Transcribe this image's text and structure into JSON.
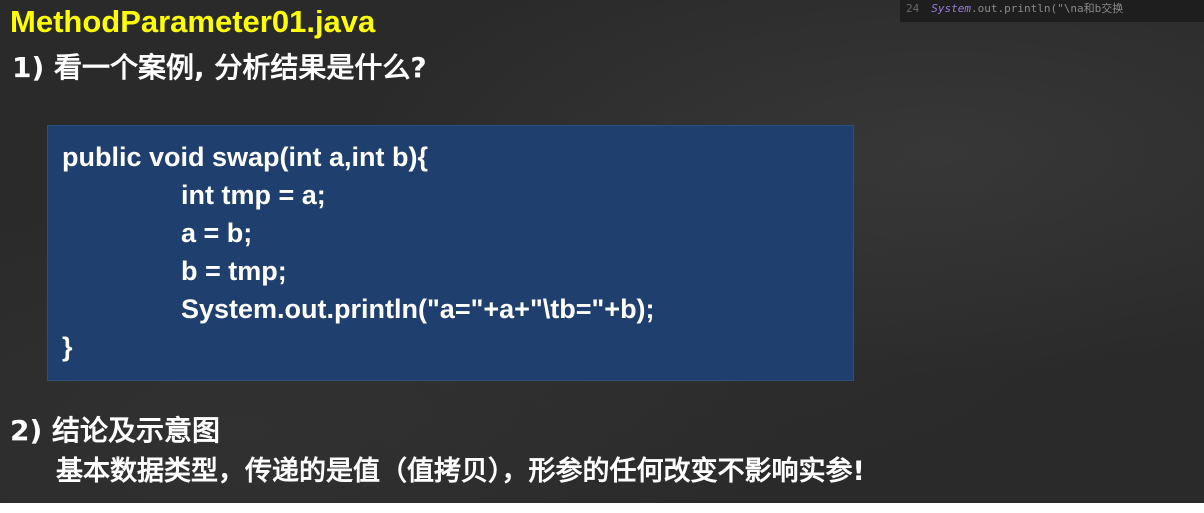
{
  "slide": {
    "title": "MethodParameter01.java",
    "section1_heading": "1) 看一个案例, 分析结果是什么?",
    "code_lines": [
      "public void swap(int a,int b){",
      "int tmp = a;",
      "a = b;",
      "b = tmp;",
      "System.out.println(\"a=\"+a+\"\\tb=\"+b);",
      "}"
    ],
    "section2_heading": "2) 结论及示意图",
    "conclusion": "基本数据类型，传递的是值（值拷贝），形参的任何改变不影响实参!"
  },
  "background_editor": {
    "line_number": "24",
    "code_keyword": "System",
    "code_rest": ".out.println(\"\\na和b交换"
  },
  "colors": {
    "title": "#ffff00",
    "text": "#ffffff",
    "code_box": "#1f3f6e",
    "background": "#2a2a2a"
  }
}
